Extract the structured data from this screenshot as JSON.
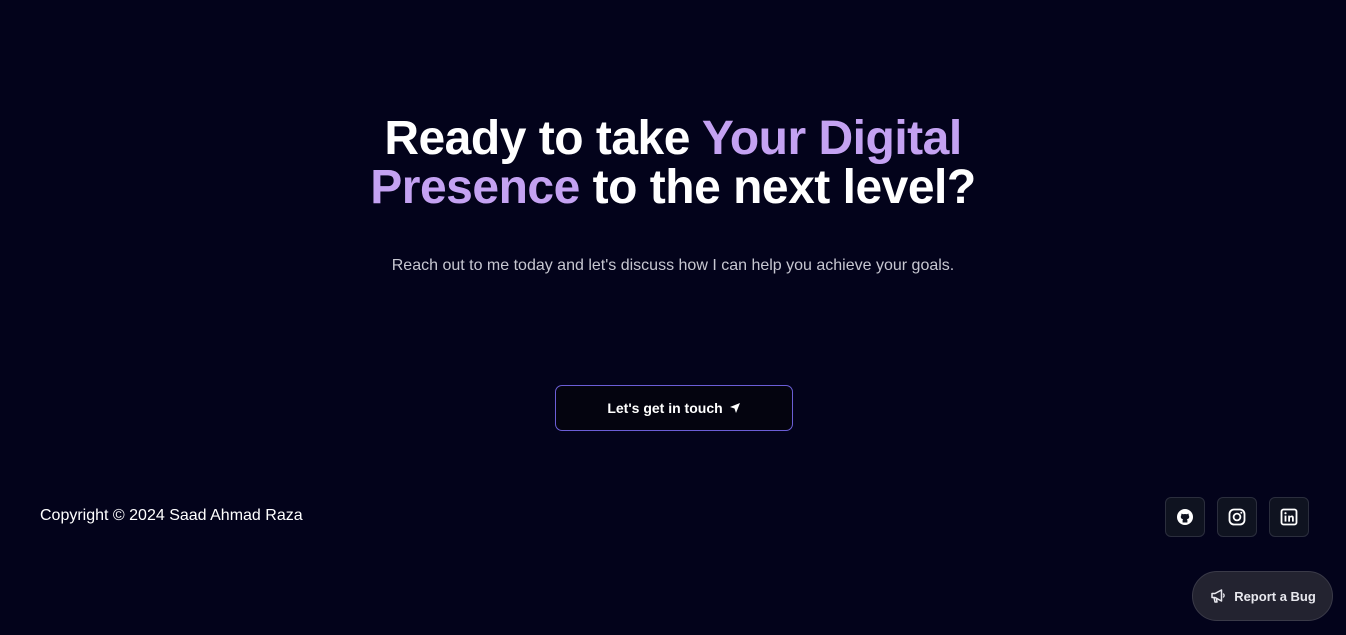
{
  "hero": {
    "headline_part1": "Ready to take ",
    "headline_accent": "Your Digital Presence",
    "headline_part2": " to the next level?",
    "subtitle": "Reach out to me today and let's discuss how I can help you achieve your goals.",
    "cta_label": "Let's get in touch",
    "cta_icon": "send-arrow-icon"
  },
  "footer": {
    "copyright": "Copyright © 2024 Saad Ahmad Raza",
    "socials": [
      {
        "name": "GitHub",
        "icon": "github-icon"
      },
      {
        "name": "Instagram",
        "icon": "instagram-icon"
      },
      {
        "name": "LinkedIn",
        "icon": "linkedin-icon"
      }
    ]
  },
  "report_bug": {
    "label": "Report a Bug",
    "icon": "megaphone-icon"
  },
  "colors": {
    "background": "#03031b",
    "accent": "#c4a2f2",
    "button_border": "#6b5ed6"
  }
}
